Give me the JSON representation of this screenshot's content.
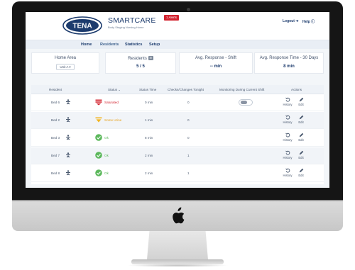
{
  "header": {
    "logo_text": "TENA",
    "brand_name": "SMARTCARE",
    "brand_tagline": "Body Staging Nursing Home",
    "alerts_badge": "1 Alerts",
    "logout_label": "Logout ➔",
    "help_label": "Help ⓘ"
  },
  "nav": {
    "items": [
      {
        "label": "Home"
      },
      {
        "label": "Residents"
      },
      {
        "label": "Statistics"
      },
      {
        "label": "Setup"
      }
    ]
  },
  "summary": {
    "home_area_label": "Home Area",
    "home_area_value": "Unit A ▾",
    "residents_label": "Residents",
    "residents_value": "5 / 5",
    "avg_shift_label": "Avg. Response - Shift",
    "avg_shift_value": "-- min",
    "avg_30_label": "Avg. Response Time - 30 Days",
    "avg_30_value": "8 min"
  },
  "table": {
    "columns": [
      "Resident",
      "Status ⌄",
      "Status Time",
      "Checks/Changes Tonight",
      "Monitoring During Current Shift",
      "Actions"
    ],
    "action_labels": {
      "history": "History",
      "edit": "Edit"
    },
    "rows": [
      {
        "resident": "Bed 6",
        "status": "Saturated",
        "status_kind": "saturated",
        "status_time": "0 min",
        "checks": "0",
        "monitoring": "off"
      },
      {
        "resident": "Bed 2",
        "status": "Some Urine",
        "status_kind": "urine",
        "status_time": "1 min",
        "checks": "0",
        "monitoring": ""
      },
      {
        "resident": "Bed 3",
        "status": "Ok",
        "status_kind": "ok",
        "status_time": "8 min",
        "checks": "0",
        "monitoring": ""
      },
      {
        "resident": "Bed 7",
        "status": "Ok",
        "status_kind": "ok",
        "status_time": "2 min",
        "checks": "1",
        "monitoring": ""
      },
      {
        "resident": "Bed 8",
        "status": "Ok",
        "status_kind": "ok",
        "status_time": "2 min",
        "checks": "1",
        "monitoring": ""
      }
    ]
  },
  "colors": {
    "brand_navy": "#1c3b6d",
    "saturated_red": "#d3232f",
    "urine_yellow": "#f2b521",
    "ok_green": "#5cb85c",
    "alert_red": "#d3232f"
  },
  "icons": {
    "device_logo": "apple-logo",
    "resident": "person-lying-icon",
    "history": "history-icon",
    "edit": "pencil-icon"
  }
}
